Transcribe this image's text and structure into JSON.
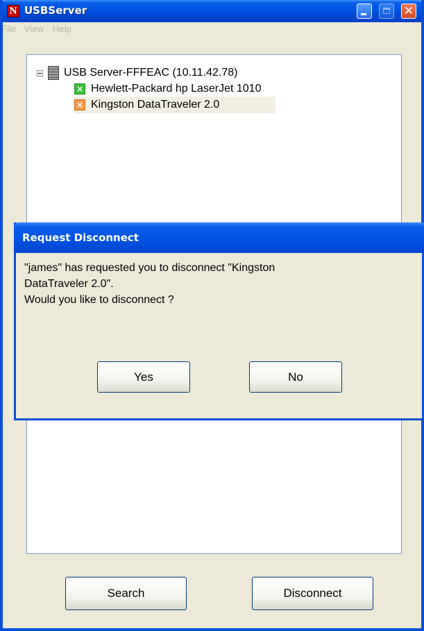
{
  "window": {
    "title": "USBServer",
    "app_icon_letter": "N",
    "controls": {
      "minimize_icon": "minimize-icon",
      "maximize_icon": "maximize-icon",
      "close_icon": "close-icon",
      "close_glyph": "✕"
    }
  },
  "menu": {
    "items": [
      {
        "label": "File"
      },
      {
        "label": "View"
      },
      {
        "label": "Help"
      }
    ]
  },
  "tree": {
    "server": {
      "label": "USB Server-FFFEAC (10.11.42.78)",
      "icon": "server-icon",
      "expanded": true
    },
    "devices": [
      {
        "label": "Hewlett-Packard hp LaserJet 1010",
        "icon": "usb-device-icon",
        "status_color": "#3cc23c"
      },
      {
        "label": "Kingston DataTraveler 2.0",
        "icon": "usb-device-icon",
        "status_color": "#f59a4a"
      }
    ]
  },
  "buttons": {
    "search": "Search",
    "disconnect": "Disconnect"
  },
  "dialog": {
    "title": "Request Disconnect",
    "message_line1": "\"james\" has requested you to disconnect \"Kingston",
    "message_line2": "DataTraveler 2.0\".",
    "message_line3": "Would you like to disconnect ?",
    "yes": "Yes",
    "no": "No"
  },
  "colors": {
    "titlebar_blue": "#0055e5",
    "window_face": "#ece9d8",
    "device_connected": "#3cc23c",
    "device_in_use": "#f59a4a"
  }
}
